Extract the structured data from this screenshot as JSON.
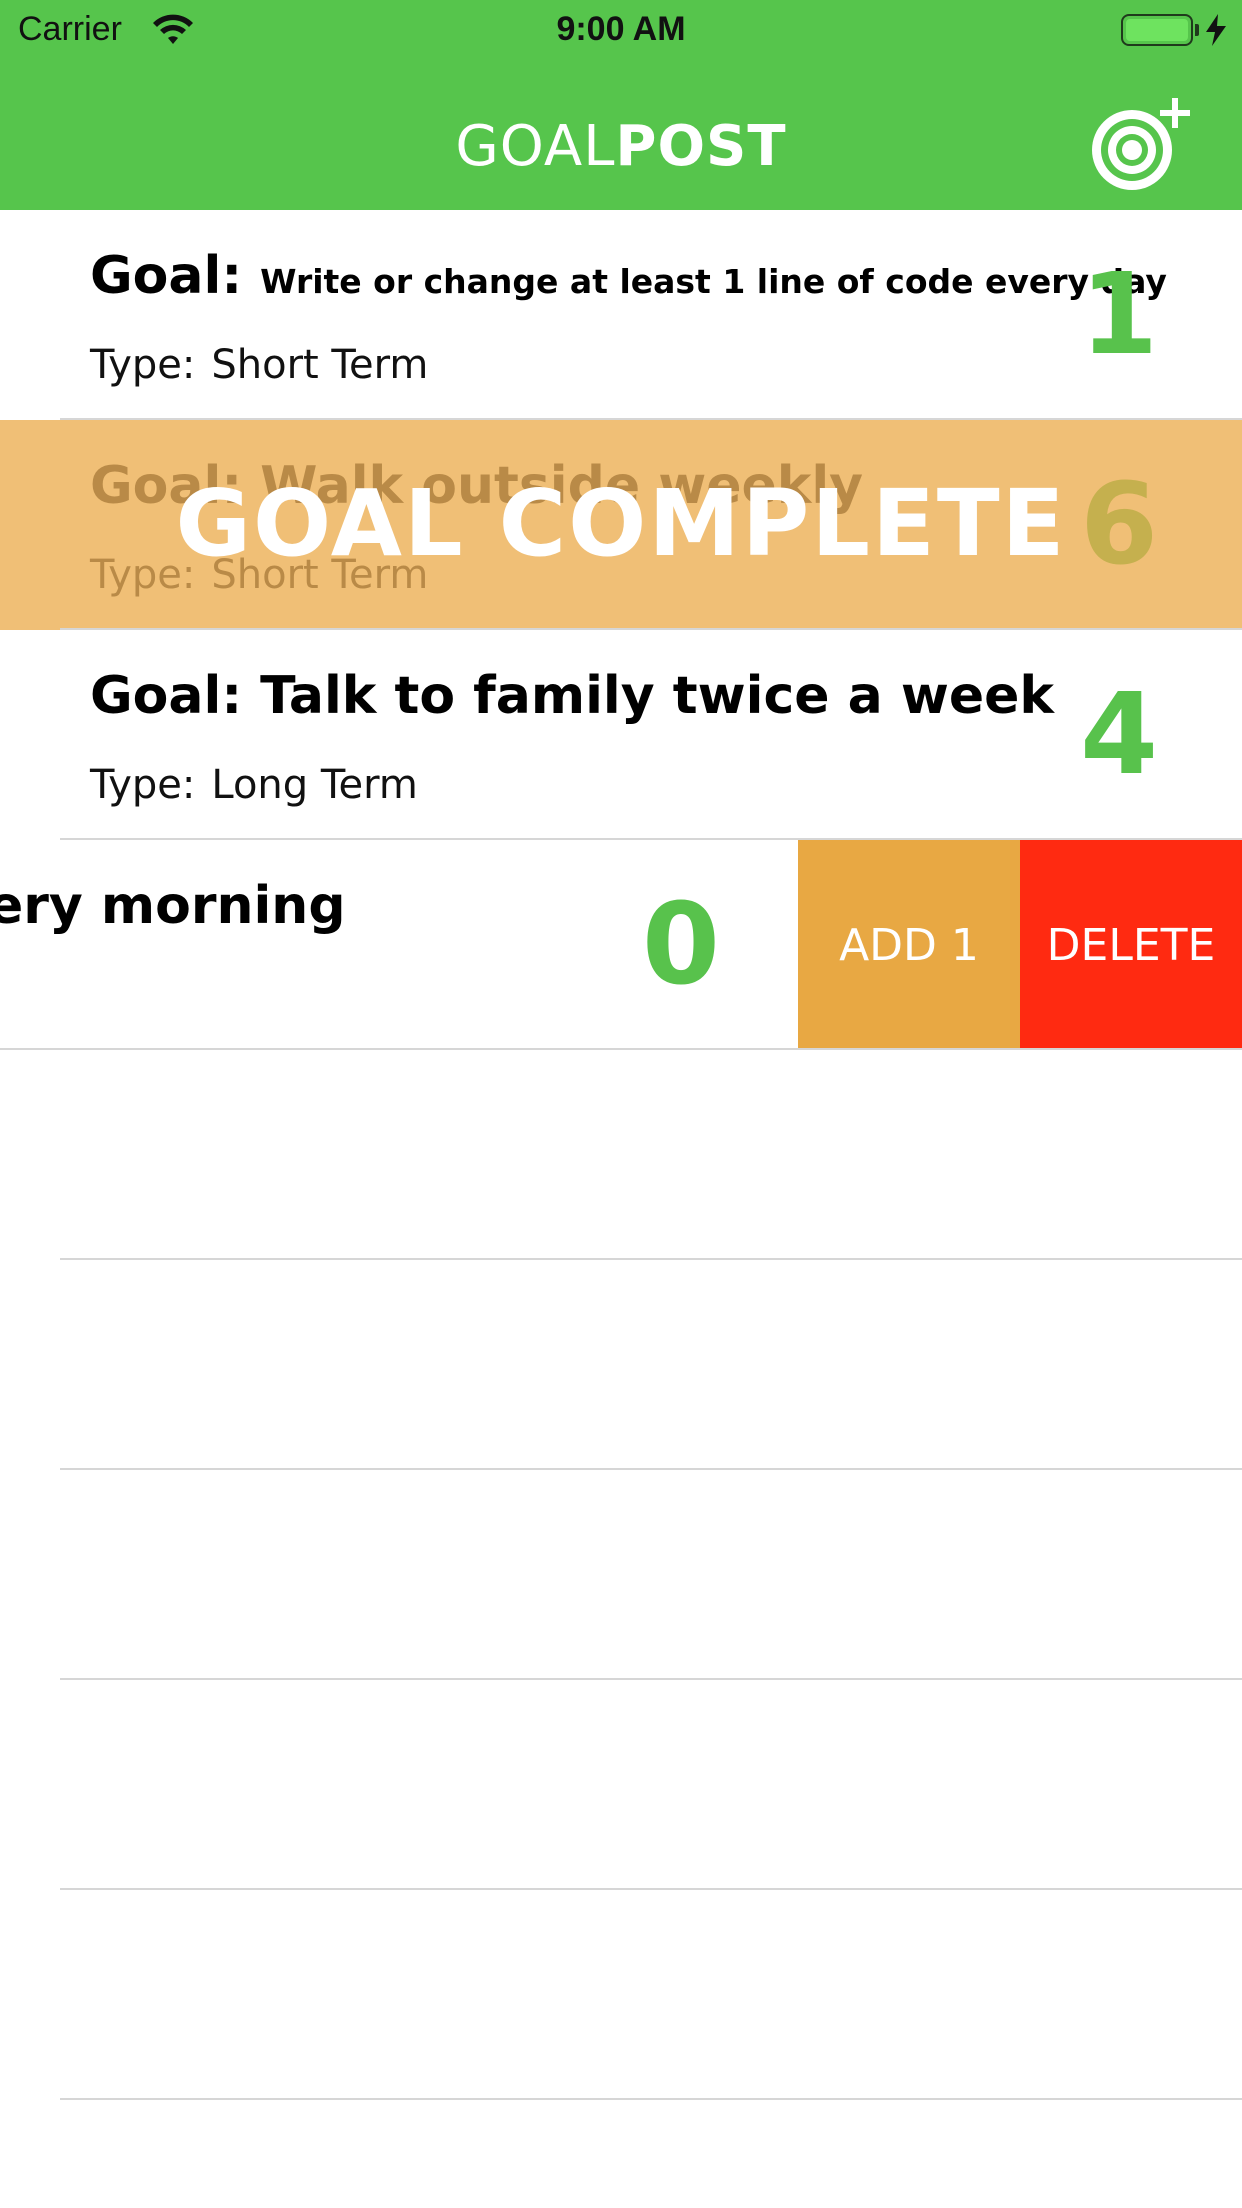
{
  "status_bar": {
    "carrier": "Carrier",
    "time": "9:00 AM"
  },
  "nav": {
    "brand_light": "GOAL",
    "brand_bold": "POST",
    "add_icon": "target-plus-icon"
  },
  "goals": [
    {
      "goal_label": "Goal:",
      "text": "Write or change at least 1 line of code every day",
      "type_label": "Type:",
      "type": "Short Term",
      "progress": "1"
    },
    {
      "goal_label": "Goal:",
      "text": "Walk outside weekly",
      "type_label": "Type:",
      "type": "Short Term",
      "progress": "6",
      "overlay": "GOAL COMPLETE"
    },
    {
      "goal_label": "Goal:",
      "text": "Talk to family twice a week",
      "type_label": "Type:",
      "type": "Long Term",
      "progress": "4"
    },
    {
      "text_partial": "ery morning",
      "progress": "0",
      "actions": {
        "add": "ADD 1",
        "delete": "DELETE"
      }
    }
  ],
  "colors": {
    "nav_green": "#56c54c",
    "progress_green": "#58c24c",
    "complete_bg": "#f0bf76",
    "add_action": "#e8a843",
    "delete_action": "#ff2a11"
  }
}
